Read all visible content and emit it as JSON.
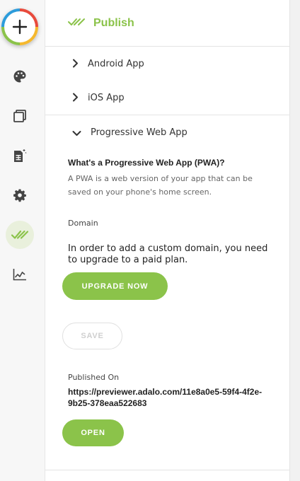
{
  "colors": {
    "accent": "#8bc34a",
    "rail_bg": "#f7f7f7",
    "active_rail_bg": "#e9f0dc",
    "text": "#333333"
  },
  "rail": {
    "add_icon": "plus-icon",
    "items": [
      {
        "name": "palette-icon"
      },
      {
        "name": "screens-icon"
      },
      {
        "name": "database-icon"
      },
      {
        "name": "gear-icon"
      },
      {
        "name": "publish-check-icon",
        "active": true
      },
      {
        "name": "analytics-icon"
      }
    ]
  },
  "header": {
    "title": "Publish"
  },
  "sections": {
    "android": "Android App",
    "ios": "iOS App",
    "pwa": "Progressive Web App"
  },
  "pwa": {
    "heading": "What's a Progressive Web App (PWA)?",
    "description": "A PWA is a web version of your app that can be saved on your phone's home screen.",
    "domain_label": "Domain",
    "domain_message": "In order to add a custom domain, you need to upgrade to a paid plan.",
    "upgrade_label": "UPGRADE NOW",
    "save_label": "SAVE",
    "published_label": "Published On",
    "published_url": "https://previewer.adalo.com/11e8a0e5-59f4-4f2e-9b25-378eaa522683",
    "open_label": "OPEN"
  }
}
